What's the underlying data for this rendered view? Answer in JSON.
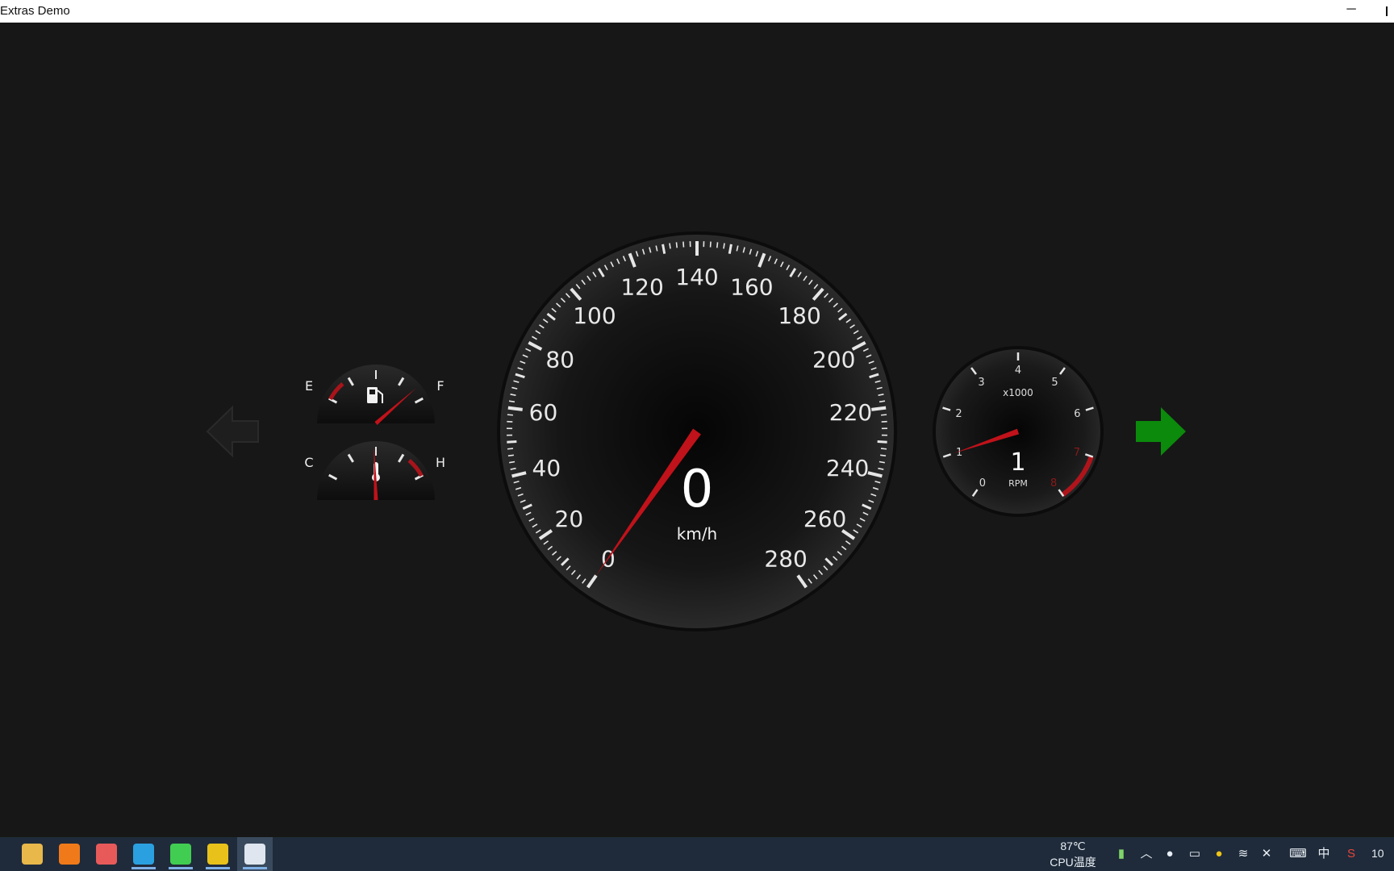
{
  "window": {
    "title": "Extras Demo",
    "minimize_glyph": "─"
  },
  "turn_signals": {
    "left": {
      "icon": "arrow-left-icon",
      "active": false,
      "color": "#1e1e1e"
    },
    "right": {
      "icon": "arrow-right-icon",
      "active": true,
      "color": "#0b8a0b"
    }
  },
  "fuel_gauge": {
    "label_empty": "E",
    "label_full": "F",
    "icon": "fuel-pump-icon",
    "level": 1.0
  },
  "temp_gauge": {
    "label_cold": "C",
    "label_hot": "H",
    "icon": "thermometer-icon",
    "level": 0.5
  },
  "speedometer": {
    "value": "0",
    "unit": "km/h",
    "min": 0,
    "max": 280,
    "needle_value": 0,
    "tick_labels": [
      "0",
      "20",
      "40",
      "60",
      "80",
      "100",
      "120",
      "140",
      "160",
      "180",
      "200",
      "220",
      "240",
      "260",
      "280"
    ],
    "needle_color": "#c0121a"
  },
  "tachometer": {
    "value": "1",
    "unit": "RPM",
    "multiplier": "x1000",
    "min": 0,
    "max": 8,
    "needle_value": 1,
    "redline_from": 7,
    "tick_labels": [
      "0",
      "1",
      "2",
      "3",
      "4",
      "5",
      "6",
      "7",
      "8"
    ]
  },
  "taskbar": {
    "apps": [
      {
        "name": "file-explorer-icon",
        "color": "#e8b84a"
      },
      {
        "name": "search-icon",
        "color": "#f07a1a"
      },
      {
        "name": "app-icon-1",
        "color": "#e85a5a"
      },
      {
        "name": "edge-icon",
        "color": "#2aa0e0"
      },
      {
        "name": "qt-creator-icon",
        "color": "#41cd52"
      },
      {
        "name": "app-icon-2",
        "color": "#e8c21a"
      },
      {
        "name": "extras-demo-icon",
        "color": "#dfe6ef"
      }
    ],
    "cpu_temp": "87℃",
    "cpu_label": "CPU温度",
    "ime": "中",
    "clock": "10"
  }
}
